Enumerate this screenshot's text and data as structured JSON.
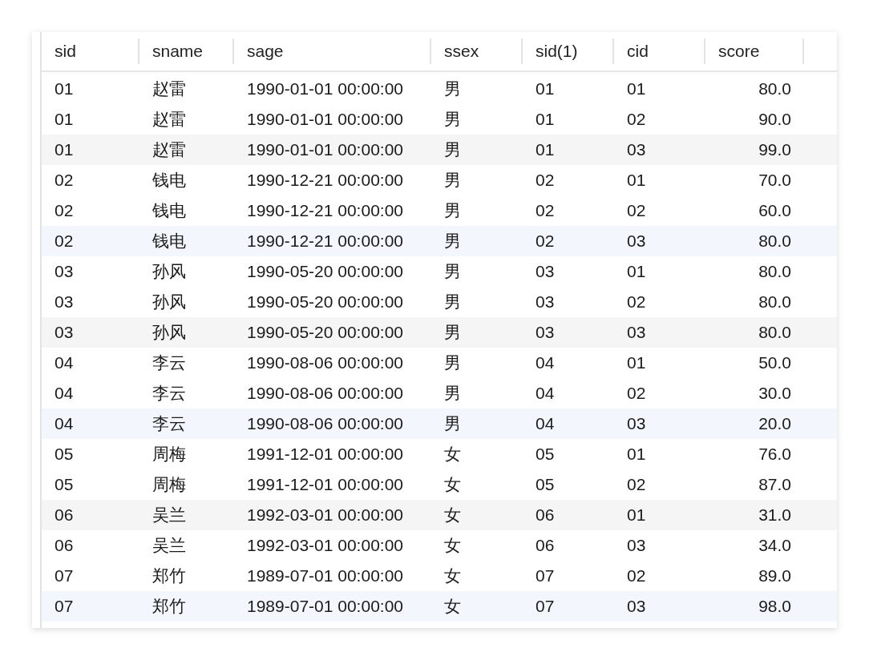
{
  "table": {
    "columns": [
      "sid",
      "sname",
      "sage",
      "ssex",
      "sid(1)",
      "cid",
      "score"
    ],
    "rows": [
      {
        "color": "#ffffff",
        "cells": [
          "01",
          "赵雷",
          "1990-01-01 00:00:00",
          "男",
          "01",
          "01",
          "80.0"
        ]
      },
      {
        "color": "#ffffff",
        "cells": [
          "01",
          "赵雷",
          "1990-01-01 00:00:00",
          "男",
          "01",
          "02",
          "90.0"
        ]
      },
      {
        "color": "#f5f5f5",
        "cells": [
          "01",
          "赵雷",
          "1990-01-01 00:00:00",
          "男",
          "01",
          "03",
          "99.0"
        ]
      },
      {
        "color": "#ffffff",
        "cells": [
          "02",
          "钱电",
          "1990-12-21 00:00:00",
          "男",
          "02",
          "01",
          "70.0"
        ]
      },
      {
        "color": "#ffffff",
        "cells": [
          "02",
          "钱电",
          "1990-12-21 00:00:00",
          "男",
          "02",
          "02",
          "60.0"
        ]
      },
      {
        "color": "#f3f7fd",
        "cells": [
          "02",
          "钱电",
          "1990-12-21 00:00:00",
          "男",
          "02",
          "03",
          "80.0"
        ]
      },
      {
        "color": "#ffffff",
        "cells": [
          "03",
          "孙风",
          "1990-05-20 00:00:00",
          "男",
          "03",
          "01",
          "80.0"
        ]
      },
      {
        "color": "#ffffff",
        "cells": [
          "03",
          "孙风",
          "1990-05-20 00:00:00",
          "男",
          "03",
          "02",
          "80.0"
        ]
      },
      {
        "color": "#f5f5f5",
        "cells": [
          "03",
          "孙风",
          "1990-05-20 00:00:00",
          "男",
          "03",
          "03",
          "80.0"
        ]
      },
      {
        "color": "#ffffff",
        "cells": [
          "04",
          "李云",
          "1990-08-06 00:00:00",
          "男",
          "04",
          "01",
          "50.0"
        ]
      },
      {
        "color": "#ffffff",
        "cells": [
          "04",
          "李云",
          "1990-08-06 00:00:00",
          "男",
          "04",
          "02",
          "30.0"
        ]
      },
      {
        "color": "#f3f7fd",
        "cells": [
          "04",
          "李云",
          "1990-08-06 00:00:00",
          "男",
          "04",
          "03",
          "20.0"
        ]
      },
      {
        "color": "#ffffff",
        "cells": [
          "05",
          "周梅",
          "1991-12-01 00:00:00",
          "女",
          "05",
          "01",
          "76.0"
        ]
      },
      {
        "color": "#ffffff",
        "cells": [
          "05",
          "周梅",
          "1991-12-01 00:00:00",
          "女",
          "05",
          "02",
          "87.0"
        ]
      },
      {
        "color": "#f5f5f5",
        "cells": [
          "06",
          "吴兰",
          "1992-03-01 00:00:00",
          "女",
          "06",
          "01",
          "31.0"
        ]
      },
      {
        "color": "#ffffff",
        "cells": [
          "06",
          "吴兰",
          "1992-03-01 00:00:00",
          "女",
          "06",
          "03",
          "34.0"
        ]
      },
      {
        "color": "#ffffff",
        "cells": [
          "07",
          "郑竹",
          "1989-07-01 00:00:00",
          "女",
          "07",
          "02",
          "89.0"
        ]
      },
      {
        "color": "#f3f7fd",
        "cells": [
          "07",
          "郑竹",
          "1989-07-01 00:00:00",
          "女",
          "07",
          "03",
          "98.0"
        ]
      }
    ]
  }
}
